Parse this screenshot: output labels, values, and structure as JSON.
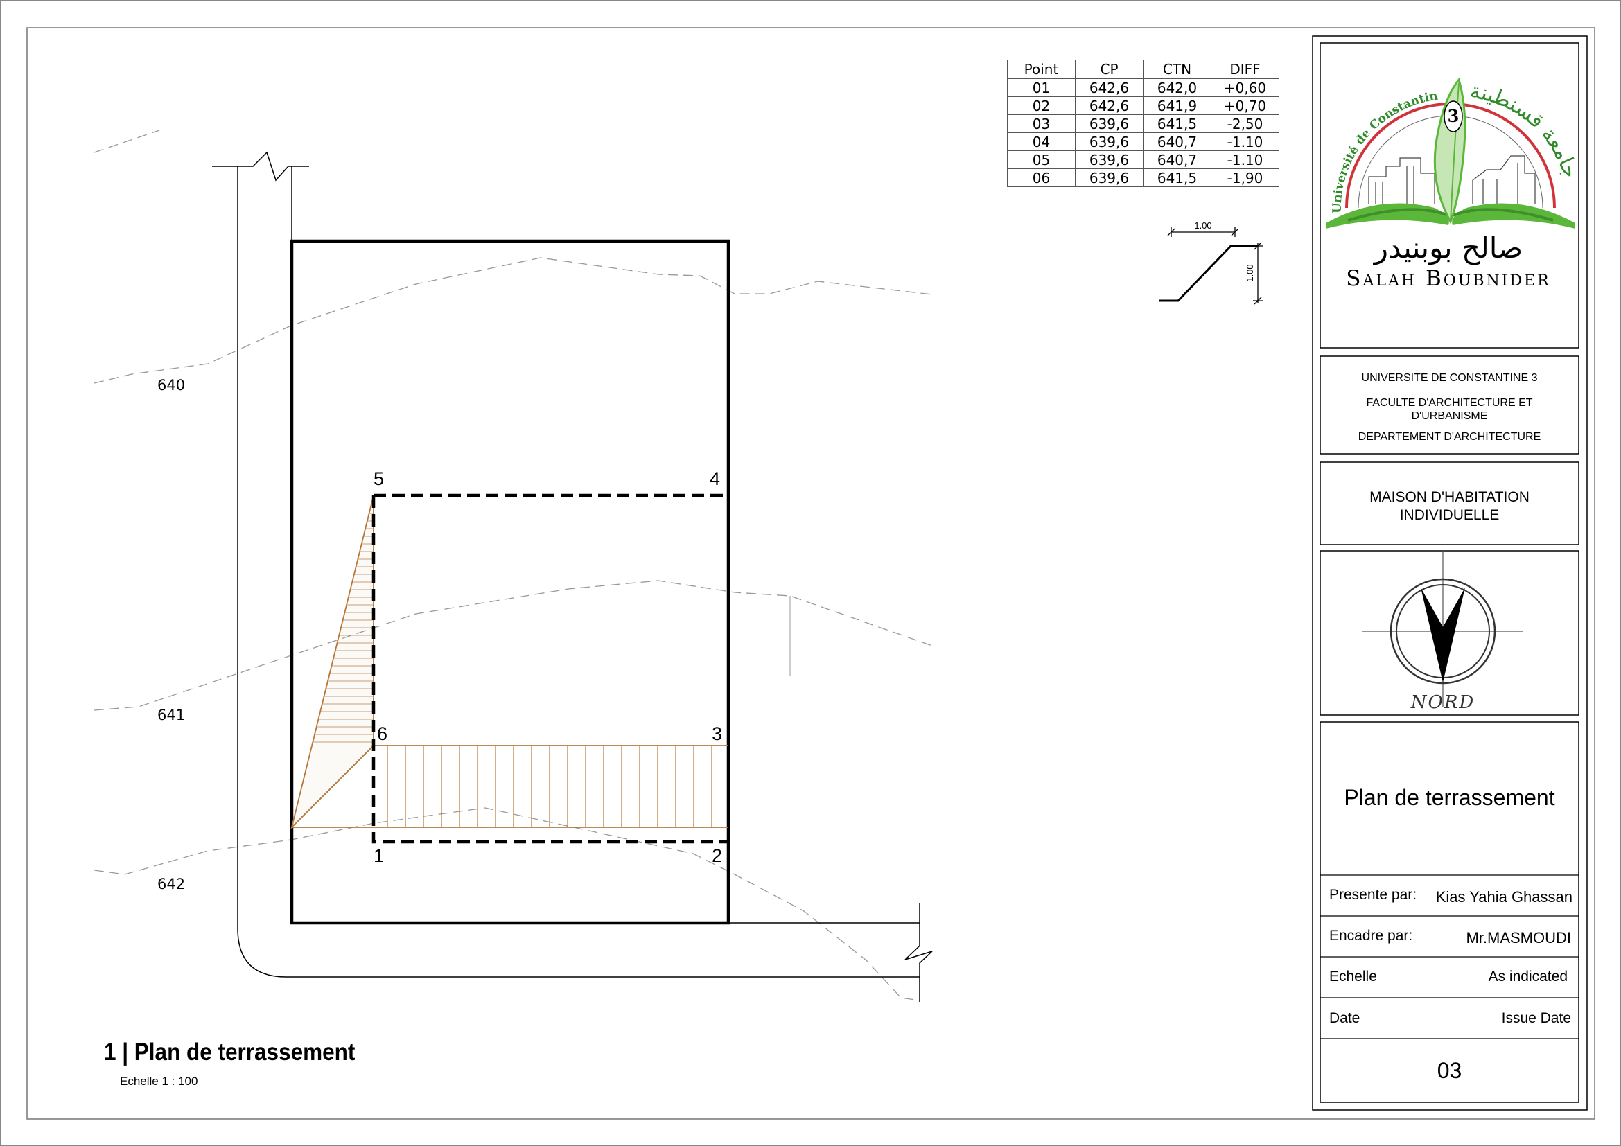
{
  "drawing": {
    "contour_labels": [
      "640",
      "641",
      "642"
    ],
    "point_labels": [
      "1",
      "2",
      "3",
      "4",
      "5",
      "6"
    ],
    "view_title": "1 | Plan de terrassement",
    "view_scale": "Echelle 1 : 100"
  },
  "slope_detail": {
    "horizontal": "1.00",
    "vertical": "1.00"
  },
  "points_table": {
    "headers": [
      "Point",
      "CP",
      "CTN",
      "DIFF"
    ],
    "rows": [
      [
        "01",
        "642,6",
        "642,0",
        "+0,60"
      ],
      [
        "02",
        "642,6",
        "641,9",
        "+0,70"
      ],
      [
        "03",
        "639,6",
        "641,5",
        "-2,50"
      ],
      [
        "04",
        "639,6",
        "640,7",
        "-1.10"
      ],
      [
        "05",
        "639,6",
        "640,7",
        "-1.10"
      ],
      [
        "06",
        "639,6",
        "641,5",
        "-1,90"
      ]
    ]
  },
  "title_block": {
    "logo": {
      "arc_text_fr": "Université de Constantine",
      "arc_text_ar": "جامعة قسنطينة",
      "number": "3",
      "name_ar": "صالح بوبنيدر",
      "name_fr": "Salah Boubnider"
    },
    "institution": {
      "line1": "UNIVERSITE DE CONSTANTINE 3",
      "line2a": "FACULTE D'ARCHITECTURE ET",
      "line2b": "D'URBANISME",
      "line3": "DEPARTEMENT D'ARCHITECTURE"
    },
    "project": {
      "line1": "MAISON D'HABITATION",
      "line2": "INDIVIDUELLE"
    },
    "north_label": "NORD",
    "sheet_title": "Plan de terrassement",
    "fields": [
      {
        "label": "Presente par:",
        "value": "Kias Yahia Ghassan"
      },
      {
        "label": "Encadre par:",
        "value": "Mr.MASMOUDI"
      },
      {
        "label": "Echelle",
        "value": "As indicated"
      },
      {
        "label": "Date",
        "value": "Issue Date"
      }
    ],
    "sheet_number": "03"
  },
  "colors": {
    "cut_fill": "#b5773a",
    "logo_green": "#5bb73a",
    "logo_red": "#d0343a"
  }
}
